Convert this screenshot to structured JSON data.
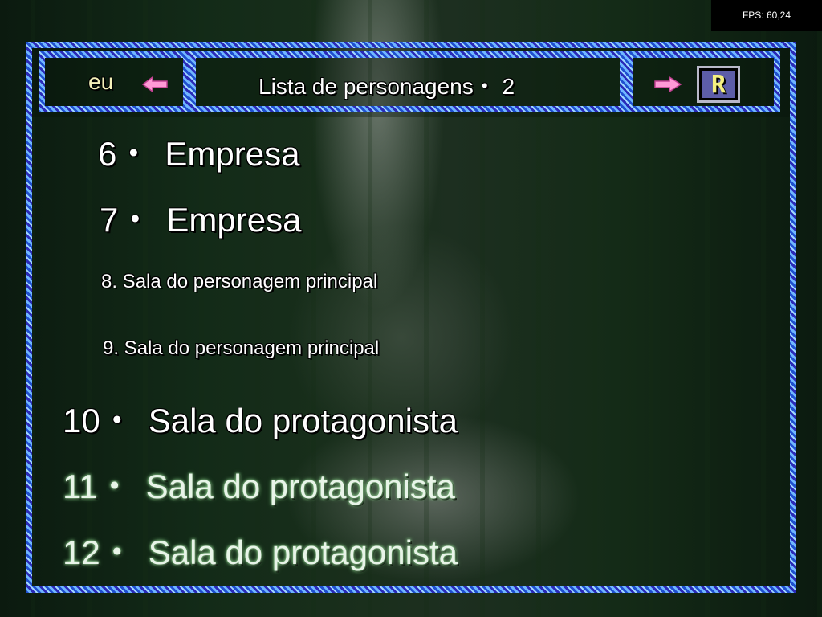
{
  "fps": "FPS: 60,24",
  "header": {
    "left_label": "eu",
    "title": "Lista de personagens・ 2",
    "right_button": "R"
  },
  "icons": {
    "prev": "arrow-left-icon",
    "next": "arrow-right-icon",
    "r": "r-key-icon"
  },
  "colors": {
    "border_blue": "#1f4fd0",
    "border_light": "#6fb6ff",
    "arrow_pink": "#ff9ad6",
    "eu_text": "#f3f0b8"
  },
  "list": [
    {
      "num": "6・",
      "label": "Empresa"
    },
    {
      "num": "7・",
      "label": "Empresa"
    },
    {
      "text": "8. Sala do personagem principal"
    },
    {
      "text": "9. Sala do personagem principal"
    },
    {
      "num": "10・",
      "label": "Sala do protagonista"
    },
    {
      "num": "11・",
      "label": "Sala do protagonista"
    },
    {
      "num": "12・",
      "label": "Sala do protagonista"
    }
  ]
}
